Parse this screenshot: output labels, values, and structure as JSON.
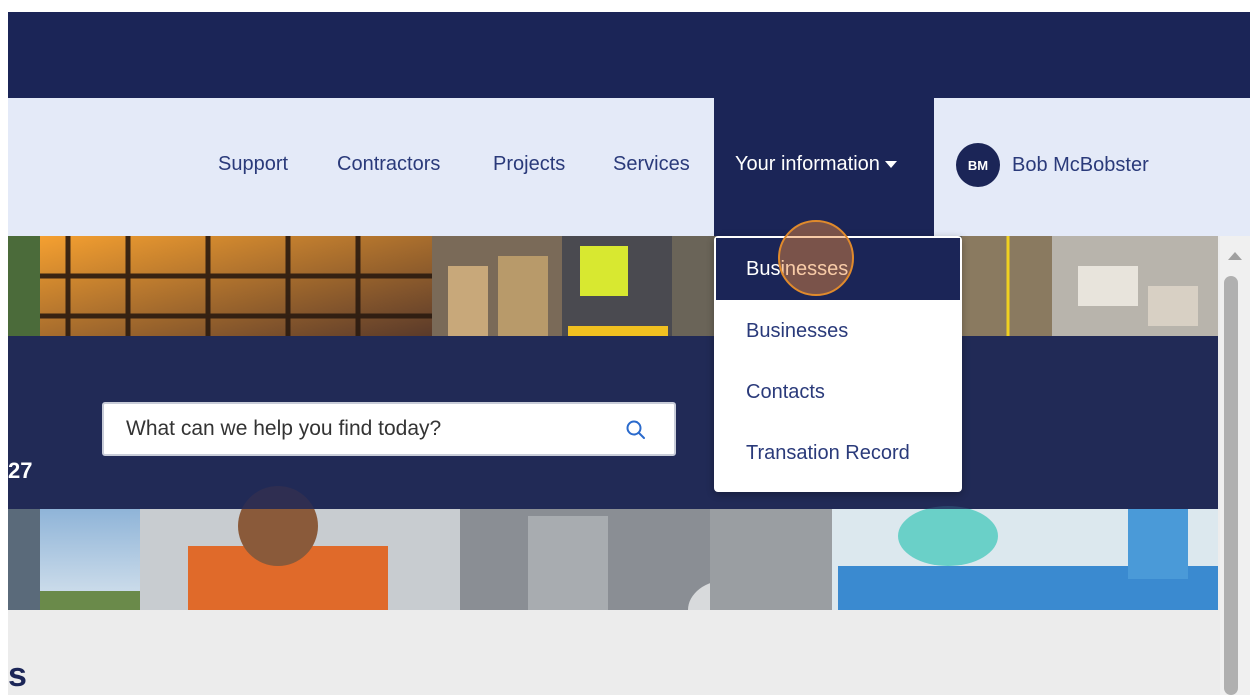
{
  "nav": {
    "links": [
      "Support",
      "Contractors",
      "Projects",
      "Services"
    ],
    "active_label": "Your information",
    "user_initials": "BM",
    "user_name": "Bob McBobster"
  },
  "dropdown": {
    "items": [
      "Businesses",
      "Businesses",
      "Contacts",
      "Transation Record"
    ],
    "highlighted_index": 0
  },
  "search": {
    "placeholder": "What can we help you find today?",
    "icon": "search-icon"
  },
  "hero": {
    "partial_text": "27"
  },
  "content": {
    "partial_heading": "s"
  },
  "colors": {
    "brand_navy": "#1b2557",
    "nav_bg": "#e4eaf8",
    "click_marker": "#e08a2c"
  }
}
